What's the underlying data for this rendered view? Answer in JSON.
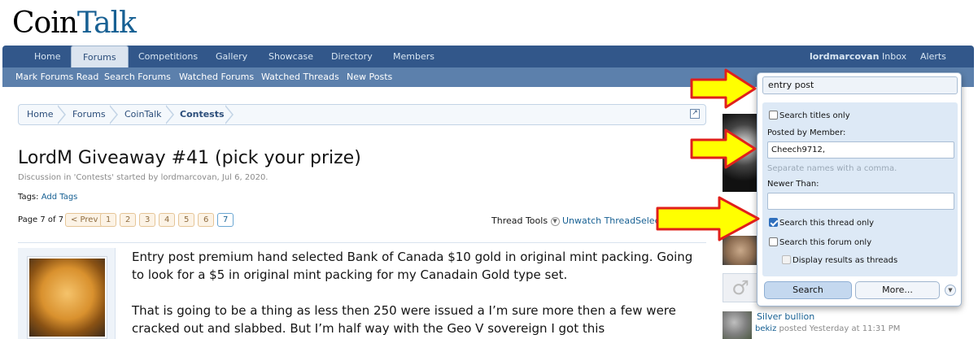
{
  "logo": {
    "part1": "Coin",
    "part2": "Talk"
  },
  "nav": {
    "tabs": [
      {
        "label": "Home"
      },
      {
        "label": "Forums"
      },
      {
        "label": "Competitions"
      },
      {
        "label": "Gallery"
      },
      {
        "label": "Showcase"
      },
      {
        "label": "Directory"
      },
      {
        "label": "Members"
      }
    ],
    "active_tab": "Forums",
    "user": "lordmarcovan",
    "inbox": "Inbox",
    "alerts": "Alerts"
  },
  "subnav": {
    "links": [
      {
        "label": "Mark Forums Read"
      },
      {
        "label": "Search Forums"
      },
      {
        "label": "Watched Forums"
      },
      {
        "label": "Watched Threads"
      },
      {
        "label": "New Posts"
      }
    ]
  },
  "breadcrumb": {
    "items": [
      {
        "label": "Home"
      },
      {
        "label": "Forums"
      },
      {
        "label": "CoinTalk"
      },
      {
        "label": "Contests"
      }
    ]
  },
  "thread": {
    "title": "LordM Giveaway #41 (pick your prize)",
    "description": "Discussion in 'Contests' started by lordmarcovan, Jul 6, 2020.",
    "tags_label": "Tags:",
    "add_tags": "Add Tags"
  },
  "pagination": {
    "label": "Page 7 of 7",
    "prev": "< Prev",
    "pages": [
      "1",
      "2",
      "3",
      "4",
      "5",
      "6",
      "7"
    ],
    "current": "7"
  },
  "thread_tools": {
    "tools_label": "Thread Tools",
    "unwatch_label": "Unwatch Thread",
    "select_label": "Selec"
  },
  "post": {
    "paragraph1": "Entry post premium hand selected Bank of Canada $10 gold in original mint packing. Going to look for a $5 in original mint packing for my Canadain Gold type set.",
    "paragraph2": "That is going to be a thing as less then 250 were issued a I’m sure more then a few were cracked out and slabbed. But I’m half way with the Geo V sovereign I got this"
  },
  "sidebar": {
    "recent_title": "Silver bullion",
    "recent_user": "bekiz",
    "recent_meta": "posted Yesterday at 11:31 PM"
  },
  "search_popup": {
    "query": "entry post",
    "titles_only_label": "Search titles only",
    "titles_only_checked": false,
    "posted_by_label": "Posted by Member:",
    "posted_by_value": "Cheech9712,",
    "posted_by_hint": "Separate names with a comma.",
    "newer_than_label": "Newer Than:",
    "newer_than_value": "",
    "this_thread_label": "Search this thread only",
    "this_thread_checked": true,
    "this_forum_label": "Search this forum only",
    "this_forum_checked": false,
    "as_threads_label": "Display results as threads",
    "as_threads_checked": false,
    "search_button": "Search",
    "more_button": "More..."
  },
  "colors": {
    "nav_bg": "#32578a",
    "subnav_bg": "#5c80ac",
    "link": "#176093",
    "popup_panel": "#dde9f6",
    "arrow_fill": "#ffff00",
    "arrow_stroke": "#e0201b"
  }
}
